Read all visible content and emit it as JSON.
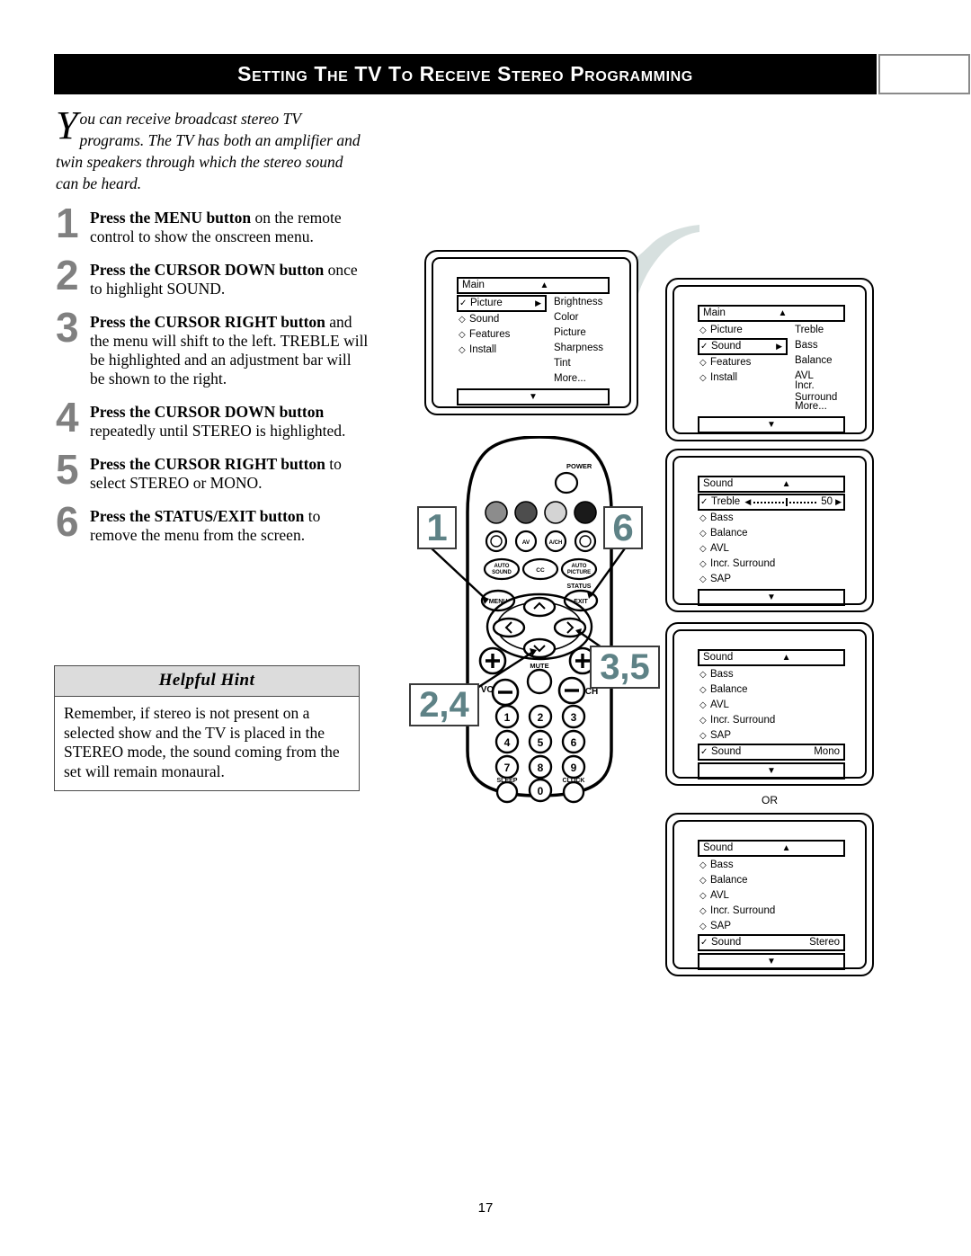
{
  "header": {
    "title": "Setting the TV to Receive Stereo Programming"
  },
  "intro": {
    "dropcap": "Y",
    "text": "ou can receive broadcast stereo TV programs.  The TV has both an amplifier and twin speakers through which the stereo sound can be heard."
  },
  "steps": [
    {
      "number": "1",
      "bold": "Press the MENU button",
      "rest": " on the remote control to show the onscreen menu."
    },
    {
      "number": "2",
      "bold": "Press the CURSOR DOWN button",
      "rest": " once to highlight SOUND."
    },
    {
      "number": "3",
      "bold": "Press the CURSOR RIGHT button",
      "rest": " and the menu will shift to the left. TREBLE will be highlighted and an adjustment bar will be shown to the right."
    },
    {
      "number": "4",
      "bold": "Press the CURSOR DOWN button",
      "rest": " repeatedly until STEREO is highlighted."
    },
    {
      "number": "5",
      "bold": "Press the CURSOR RIGHT button",
      "rest": " to select STEREO or MONO."
    },
    {
      "number": "6",
      "bold": "Press the STATUS/EXIT button",
      "rest": " to remove the menu from the screen."
    }
  ],
  "hint": {
    "title": "Helpful Hint",
    "body": "Remember, if stereo is not present on a selected show and the TV is placed in the STEREO mode, the sound coming from the set will remain monaural."
  },
  "tv_screens": [
    {
      "id": "screen-main-picture",
      "title": "Main",
      "up_glyph": "▲",
      "down_glyph": "▼",
      "left_items": [
        {
          "mark": "✓",
          "label": "Picture",
          "selected": true,
          "arrow": "▶"
        },
        {
          "mark": "◇",
          "label": "Sound",
          "selected": false,
          "arrow": ""
        },
        {
          "mark": "◇",
          "label": "Features",
          "selected": false,
          "arrow": ""
        },
        {
          "mark": "◇",
          "label": "Install",
          "selected": false,
          "arrow": ""
        }
      ],
      "right_items": [
        "Brightness",
        "Color",
        "Picture",
        "Sharpness",
        "Tint",
        "More..."
      ]
    },
    {
      "id": "screen-main-sound",
      "title": "Main",
      "up_glyph": "▲",
      "down_glyph": "▼",
      "left_items": [
        {
          "mark": "◇",
          "label": "Picture",
          "selected": false,
          "arrow": ""
        },
        {
          "mark": "✓",
          "label": "Sound",
          "selected": true,
          "arrow": "▶"
        },
        {
          "mark": "◇",
          "label": "Features",
          "selected": false,
          "arrow": ""
        },
        {
          "mark": "◇",
          "label": "Install",
          "selected": false,
          "arrow": ""
        }
      ],
      "right_items": [
        "Treble",
        "Bass",
        "Balance",
        "AVL",
        "Incr. Surround",
        "More..."
      ]
    },
    {
      "id": "screen-sound-treble",
      "title": "Sound",
      "up_glyph": "▲",
      "down_glyph": "▼",
      "slider_row": {
        "mark": "✓",
        "label": "Treble",
        "left_caret": "◀",
        "right_caret": "▶",
        "value": "50",
        "percent": 50
      },
      "items": [
        {
          "mark": "◇",
          "label": "Bass"
        },
        {
          "mark": "◇",
          "label": "Balance"
        },
        {
          "mark": "◇",
          "label": "AVL"
        },
        {
          "mark": "◇",
          "label": "Incr. Surround"
        },
        {
          "mark": "◇",
          "label": "SAP"
        }
      ]
    },
    {
      "id": "screen-sound-mono",
      "title": "Sound",
      "up_glyph": "▲",
      "down_glyph": "▼",
      "items": [
        {
          "mark": "◇",
          "label": "Bass"
        },
        {
          "mark": "◇",
          "label": "Balance"
        },
        {
          "mark": "◇",
          "label": "AVL"
        },
        {
          "mark": "◇",
          "label": "Incr. Surround"
        },
        {
          "mark": "◇",
          "label": "SAP"
        }
      ],
      "selected_row": {
        "mark": "✓",
        "label": "Sound",
        "value": "Mono"
      }
    },
    {
      "id": "screen-sound-stereo",
      "title": "Sound",
      "up_glyph": "▲",
      "down_glyph": "▼",
      "items": [
        {
          "mark": "◇",
          "label": "Bass"
        },
        {
          "mark": "◇",
          "label": "Balance"
        },
        {
          "mark": "◇",
          "label": "AVL"
        },
        {
          "mark": "◇",
          "label": "Incr. Surround"
        },
        {
          "mark": "◇",
          "label": "SAP"
        }
      ],
      "selected_row": {
        "mark": "✓",
        "label": "Sound",
        "value": "Stereo"
      }
    }
  ],
  "or_label": "OR",
  "remote": {
    "power_label": "POWER",
    "color_buttons": [
      "#8c8c8c",
      "#4d4d4d",
      "#d4d4d4",
      "#1a1a1a"
    ],
    "row_icons": [
      "☺",
      "AV",
      "A/CH",
      "☺"
    ],
    "function_buttons": [
      "AUTO SOUND",
      "CC",
      "AUTO PICTURE"
    ],
    "menu_label": "MENU",
    "status_label": "STATUS",
    "exit_label": "EXIT",
    "cursor": {
      "up": "⌃",
      "down": "⌄",
      "left": "‹",
      "right": "›"
    },
    "vol_label": "VOL",
    "ch_label": "CH",
    "mute_label": "MUTE",
    "plus": "+",
    "minus": "−",
    "keypad": [
      "1",
      "2",
      "3",
      "4",
      "5",
      "6",
      "7",
      "8",
      "9"
    ],
    "zero": "0",
    "sleep_label": "SLEEP",
    "clock_label": "CLOCK"
  },
  "callouts": [
    {
      "id": "callout-1",
      "text": "1",
      "target": "menu-button"
    },
    {
      "id": "callout-6",
      "text": "6",
      "target": "exit-button"
    },
    {
      "id": "callout-24",
      "text": "2,4",
      "target": "cursor-down-button"
    },
    {
      "id": "callout-35",
      "text": "3,5",
      "target": "cursor-right-button"
    }
  ],
  "footer": {
    "page_number": "17"
  },
  "colors": {
    "header_bg": "#000000",
    "step_number": "#808080",
    "callout_number": "#5e8286",
    "hint_header_bg": "#dcdcdc",
    "flow_arrow": "#d7e0df"
  }
}
